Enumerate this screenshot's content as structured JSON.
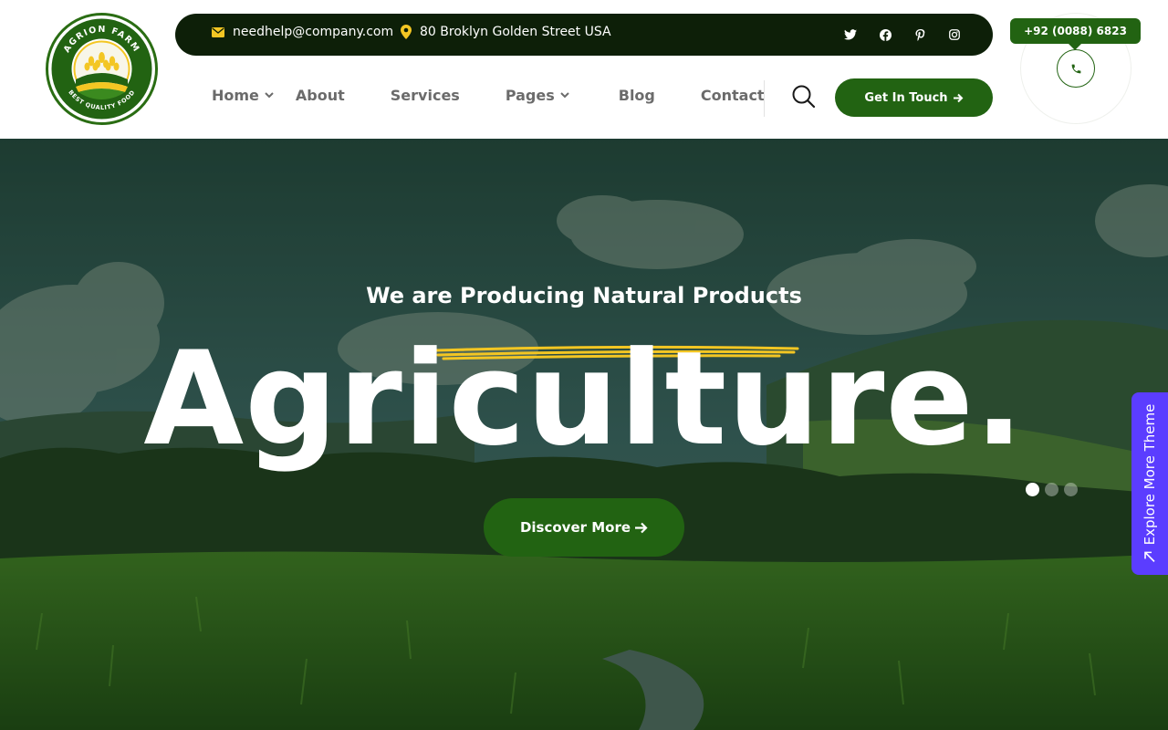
{
  "colors": {
    "brand_green": "#226312",
    "topbar_bg": "#0d1f08",
    "accent_yellow": "#f3c623",
    "explore_purple": "#5b3dff"
  },
  "logo": {
    "top_text": "AGRION FARM",
    "bottom_text": "BEST QUALITY FOOD"
  },
  "topbar": {
    "email": "needhelp@company.com",
    "address": "80 Broklyn Golden Street USA",
    "socials": [
      "twitter-icon",
      "facebook-icon",
      "pinterest-icon",
      "instagram-icon"
    ]
  },
  "nav": {
    "items": [
      {
        "label": "Home",
        "dropdown": true
      },
      {
        "label": "About",
        "dropdown": false
      },
      {
        "label": "Services",
        "dropdown": false
      },
      {
        "label": "Pages",
        "dropdown": true
      },
      {
        "label": "Blog",
        "dropdown": false
      },
      {
        "label": "Contact",
        "dropdown": false
      }
    ],
    "cta_label": "Get In Touch"
  },
  "phone": {
    "number": "+92 (0088) 6823"
  },
  "hero": {
    "subtitle": "We are Producing Natural Products",
    "title": "Agriculture.",
    "button_label": "Discover More",
    "slides": 3,
    "active_slide": 1
  },
  "explore": {
    "label": "Explore More Theme"
  }
}
